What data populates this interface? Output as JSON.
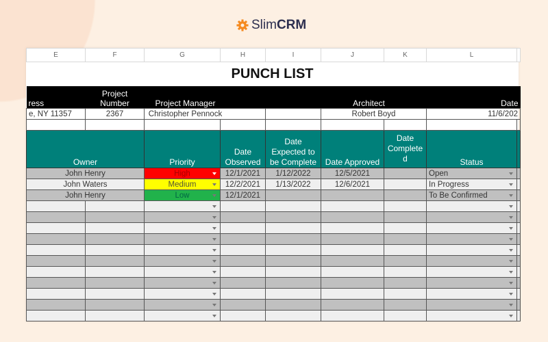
{
  "logo": {
    "brand_light": "Slim",
    "brand_bold": "CRM",
    "icon": "gear-icon",
    "accent": "#f58a20"
  },
  "columns": [
    "E",
    "F",
    "G",
    "H",
    "I",
    "J",
    "K",
    "L"
  ],
  "title": "PUNCH LIST",
  "project_headers": {
    "address": "ress",
    "project_number": "Project Number",
    "project_manager": "Project Manager",
    "architect": "Architect",
    "date": "Date"
  },
  "project_values": {
    "address": "e, NY 11357",
    "project_number": "2367",
    "project_manager": "Christopher Pennock",
    "architect": "Robert Boyd",
    "date": "11/6/202"
  },
  "table_headers": {
    "owner": "Owner",
    "priority": "Priority",
    "date_observed": "Date Observed",
    "date_expected": "Date Expected to be Complete",
    "date_approved": "Date Approved",
    "date_completed": "Date Complete d",
    "status": "Status"
  },
  "priority_colors": {
    "High": "#ff0000",
    "Medium": "#ffff00",
    "Low": "#21b24b"
  },
  "rows": [
    {
      "owner": "John Henry",
      "priority": "High",
      "date_observed": "12/1/2021",
      "date_expected": "1/12/2022",
      "date_approved": "12/5/2021",
      "date_completed": "",
      "status": "Open"
    },
    {
      "owner": "John Waters",
      "priority": "Medium",
      "date_observed": "12/2/2021",
      "date_expected": "1/13/2022",
      "date_approved": "12/6/2021",
      "date_completed": "",
      "status": "In Progress"
    },
    {
      "owner": "John Henry",
      "priority": "Low",
      "date_observed": "12/1/2021",
      "date_expected": "",
      "date_approved": "",
      "date_completed": "",
      "status": "To Be Confirmed"
    }
  ],
  "empty_rows": 11
}
